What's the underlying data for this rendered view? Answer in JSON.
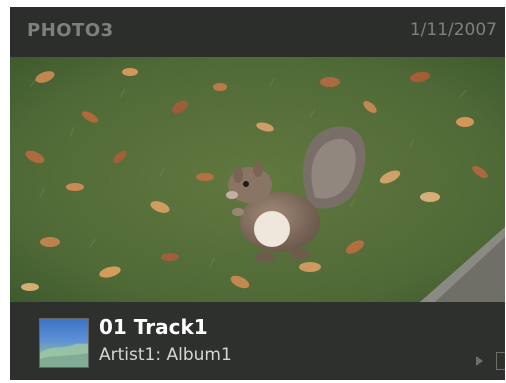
{
  "header": {
    "photo_title": "PHOTO3",
    "date": "1/11/2007"
  },
  "photo": {
    "subject": "squirrel-on-grass-with-leaves"
  },
  "now_playing": {
    "track": "01 Track1",
    "artist_album": "Artist1: Album1"
  },
  "icons": {
    "play": "play-icon",
    "edge": "panel-edge-icon"
  },
  "colors": {
    "background": "#2c2e2b",
    "title_text": "#7e807c",
    "track_text": "#ffffff",
    "artist_text": "#d6d6d6"
  }
}
